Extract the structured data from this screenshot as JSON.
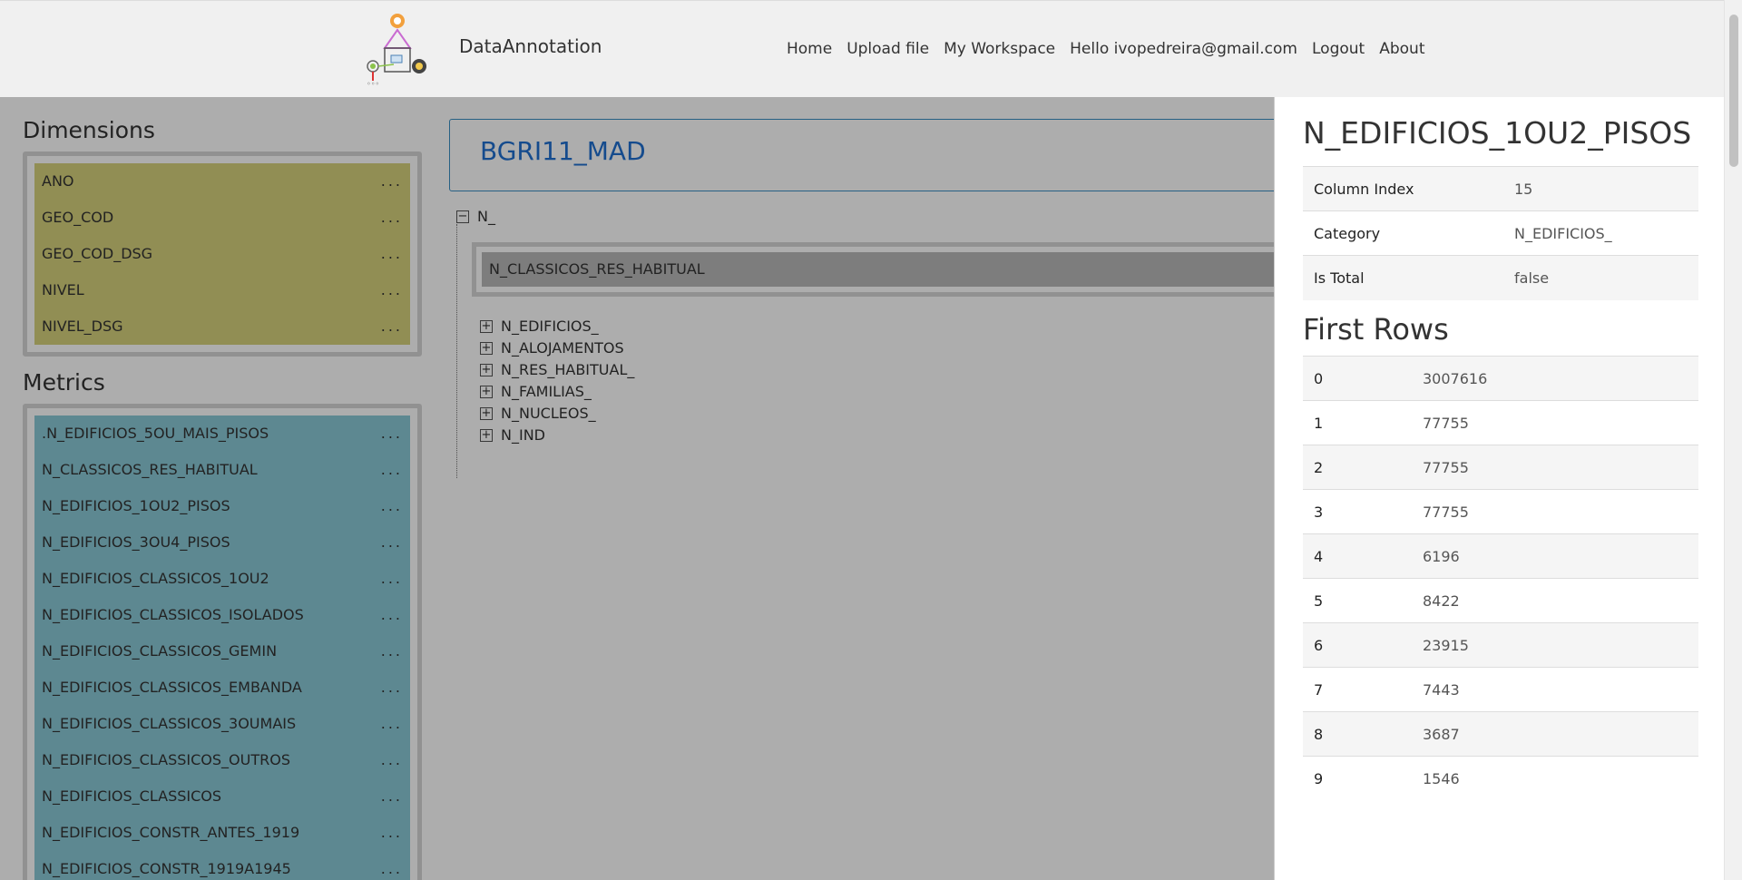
{
  "header": {
    "brand": "DataAnnotation",
    "nav": [
      "Home",
      "Upload file",
      "My Workspace",
      "Hello ivopedreira@gmail.com",
      "Logout",
      "About"
    ]
  },
  "dimensions": {
    "title": "Dimensions",
    "items": [
      "ANO",
      "GEO_COD",
      "GEO_COD_DSG",
      "NIVEL",
      "NIVEL_DSG"
    ],
    "menu": "..."
  },
  "metrics": {
    "title": "Metrics",
    "items": [
      ".N_EDIFICIOS_5OU_MAIS_PISOS",
      "N_CLASSICOS_RES_HABITUAL",
      "N_EDIFICIOS_1OU2_PISOS",
      "N_EDIFICIOS_3OU4_PISOS",
      "N_EDIFICIOS_CLASSICOS_1OU2",
      "N_EDIFICIOS_CLASSICOS_ISOLADOS",
      "N_EDIFICIOS_CLASSICOS_GEMIN",
      "N_EDIFICIOS_CLASSICOS_EMBANDA",
      "N_EDIFICIOS_CLASSICOS_3OUMAIS",
      "N_EDIFICIOS_CLASSICOS_OUTROS",
      "N_EDIFICIOS_CLASSICOS",
      "N_EDIFICIOS_CONSTR_ANTES_1919",
      "N_EDIFICIOS_CONSTR_1919A1945"
    ],
    "menu": "..."
  },
  "dataset": {
    "title": "BGRI11_MAD"
  },
  "tree": {
    "root": {
      "toggle": "−",
      "label": "N_"
    },
    "dropped_item": "N_CLASSICOS_RES_HABITUAL",
    "children": [
      {
        "toggle": "+",
        "label": "N_EDIFICIOS_"
      },
      {
        "toggle": "+",
        "label": "N_ALOJAMENTOS"
      },
      {
        "toggle": "+",
        "label": "N_RES_HABITUAL_"
      },
      {
        "toggle": "+",
        "label": "N_FAMILIAS_"
      },
      {
        "toggle": "+",
        "label": "N_NUCLEOS_"
      },
      {
        "toggle": "+",
        "label": "N_IND"
      }
    ]
  },
  "panel": {
    "title": "N_EDIFICIOS_1OU2_PISOS",
    "properties": [
      {
        "key": "Column Index",
        "value": "15"
      },
      {
        "key": "Category",
        "value": "N_EDIFICIOS_"
      },
      {
        "key": "Is Total",
        "value": "false"
      }
    ],
    "rows_title": "First Rows",
    "rows": [
      {
        "index": "0",
        "value": "3007616"
      },
      {
        "index": "1",
        "value": "77755"
      },
      {
        "index": "2",
        "value": "77755"
      },
      {
        "index": "3",
        "value": "77755"
      },
      {
        "index": "4",
        "value": "6196"
      },
      {
        "index": "5",
        "value": "8422"
      },
      {
        "index": "6",
        "value": "23915"
      },
      {
        "index": "7",
        "value": "7443"
      },
      {
        "index": "8",
        "value": "3687"
      },
      {
        "index": "9",
        "value": "1546"
      }
    ]
  }
}
